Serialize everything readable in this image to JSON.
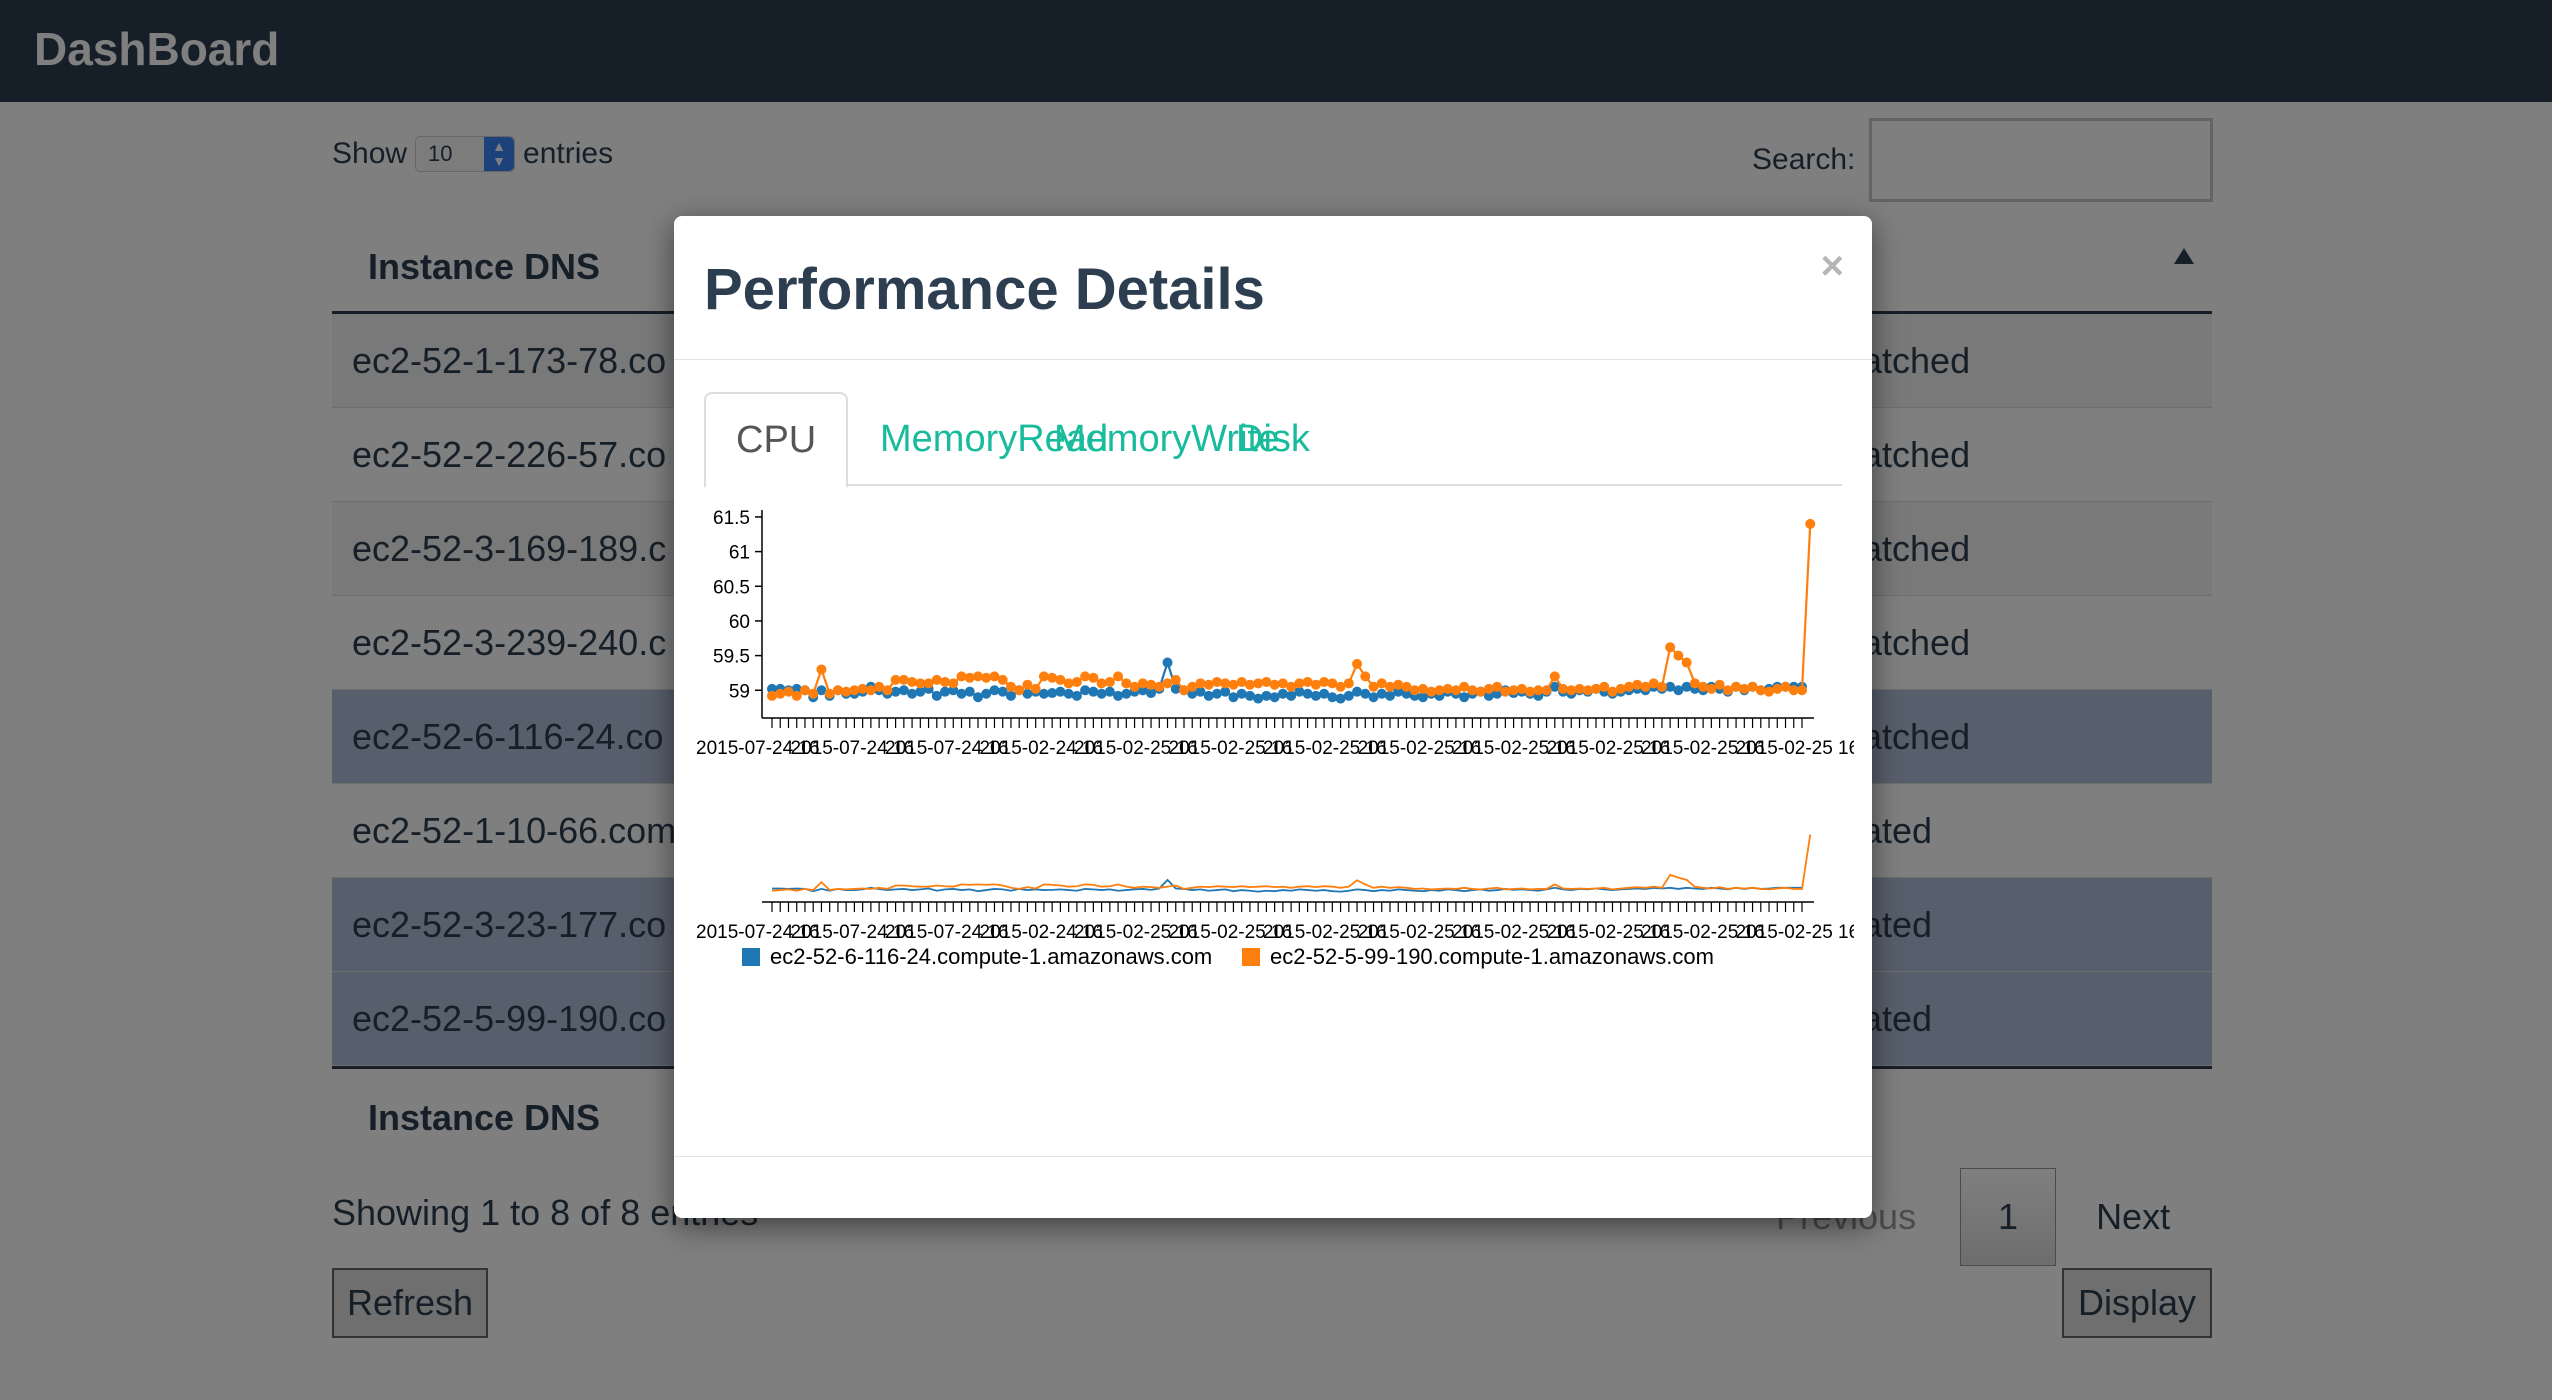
{
  "app": {
    "brand": "DashBoard"
  },
  "length_control": {
    "show_label": "Show",
    "value": "10",
    "entries_label": "entries"
  },
  "search": {
    "label": "Search:",
    "value": ""
  },
  "table": {
    "header": "Instance DNS",
    "footer": "Instance DNS",
    "rows": [
      {
        "dns": "ec2-52-1-173-78.co",
        "status": "atched",
        "selected": false
      },
      {
        "dns": "ec2-52-2-226-57.co",
        "status": "atched",
        "selected": false
      },
      {
        "dns": "ec2-52-3-169-189.c",
        "status": "atched",
        "selected": false
      },
      {
        "dns": "ec2-52-3-239-240.c",
        "status": "atched",
        "selected": false
      },
      {
        "dns": "ec2-52-6-116-24.co",
        "status": "atched",
        "selected": true
      },
      {
        "dns": "ec2-52-1-10-66.com",
        "status": "ated",
        "selected": false
      },
      {
        "dns": "ec2-52-3-23-177.co",
        "status": "ated",
        "selected": true
      },
      {
        "dns": "ec2-52-5-99-190.co",
        "status": "ated",
        "selected": true
      }
    ]
  },
  "info": "Showing 1 to 8 of 8 entries",
  "pagination": {
    "previous": "Previous",
    "current": "1",
    "next": "Next"
  },
  "buttons": {
    "refresh": "Refresh",
    "display": "Display"
  },
  "modal": {
    "title": "Performance Details",
    "close_glyph": "×",
    "tabs": [
      "CPU",
      "MemoryRead",
      "MemoryWrite",
      "Disk"
    ],
    "active_tab": "CPU"
  },
  "chart_data": {
    "type": "line",
    "y_ticks": [
      59,
      59.5,
      60,
      60.5,
      61,
      61.5
    ],
    "ylim": [
      58.6,
      61.6
    ],
    "x_tick_labels": [
      "2015-07-24 16",
      "2015-07-24 16",
      "2015-07-24 16",
      "2015-02-24 16",
      "2015-02-25 16",
      "2015-02-25 16",
      "2015-02-25 16",
      "2015-02-25 16",
      "2015-02-25 16",
      "2015-02-25 16",
      "2015-02-25 16",
      "2015-02-25 16"
    ],
    "series": [
      {
        "name": "ec2-52-6-116-24.compute-1.amazonaws.com",
        "color": "#1f77b4",
        "values": [
          59.02,
          59.02,
          59.0,
          59.02,
          59.0,
          58.9,
          59.0,
          58.92,
          59.0,
          58.95,
          58.95,
          58.98,
          59.05,
          59.0,
          58.95,
          58.98,
          59.0,
          58.95,
          58.98,
          59.02,
          58.92,
          58.98,
          59.0,
          58.95,
          58.98,
          58.9,
          58.95,
          59.0,
          58.98,
          58.92,
          59.0,
          58.95,
          58.98,
          58.95,
          58.96,
          58.98,
          58.95,
          58.92,
          59.0,
          58.98,
          58.95,
          58.98,
          58.92,
          58.95,
          58.98,
          59.0,
          58.96,
          59.02,
          59.4,
          59.02,
          59.0,
          58.95,
          58.98,
          58.92,
          58.95,
          58.98,
          58.9,
          58.95,
          58.92,
          58.88,
          58.92,
          58.9,
          58.95,
          58.92,
          58.98,
          58.95,
          58.92,
          58.95,
          58.9,
          58.88,
          58.92,
          58.98,
          58.95,
          58.9,
          58.95,
          58.92,
          58.98,
          58.95,
          58.92,
          58.9,
          58.95,
          58.92,
          58.98,
          58.95,
          58.9,
          58.95,
          58.98,
          58.92,
          58.95,
          59.0,
          58.96,
          58.98,
          58.95,
          58.92,
          58.98,
          59.05,
          58.98,
          58.95,
          59.0,
          58.98,
          59.02,
          58.98,
          58.95,
          58.98,
          59.0,
          59.02,
          59.0,
          59.05,
          59.02,
          59.05,
          59.0,
          59.05,
          59.02,
          59.0,
          59.05,
          59.02,
          58.98,
          59.05,
          59.0,
          59.05,
          59.0,
          59.02,
          59.05,
          59.05,
          59.05,
          59.05
        ]
      },
      {
        "name": "ec2-52-5-99-190.compute-1.amazonaws.com",
        "color": "#ff7f0e",
        "values": [
          58.92,
          58.95,
          58.98,
          58.92,
          59.0,
          58.95,
          59.3,
          58.95,
          59.0,
          58.98,
          59.0,
          59.02,
          59.0,
          59.05,
          59.0,
          59.15,
          59.15,
          59.12,
          59.1,
          59.1,
          59.15,
          59.12,
          59.1,
          59.2,
          59.18,
          59.2,
          59.18,
          59.2,
          59.15,
          59.05,
          59.0,
          59.08,
          59.02,
          59.2,
          59.18,
          59.15,
          59.1,
          59.12,
          59.2,
          59.18,
          59.1,
          59.12,
          59.2,
          59.1,
          59.05,
          59.1,
          59.08,
          59.05,
          59.1,
          59.15,
          59.0,
          59.05,
          59.1,
          59.08,
          59.12,
          59.1,
          59.08,
          59.12,
          59.08,
          59.1,
          59.12,
          59.08,
          59.1,
          59.05,
          59.1,
          59.12,
          59.08,
          59.12,
          59.1,
          59.05,
          59.1,
          59.38,
          59.2,
          59.05,
          59.1,
          59.05,
          59.08,
          59.05,
          59.0,
          59.02,
          58.98,
          59.0,
          59.02,
          59.0,
          59.05,
          59.0,
          58.98,
          59.02,
          59.05,
          58.98,
          59.0,
          59.02,
          58.98,
          59.0,
          59.0,
          59.2,
          59.02,
          59.0,
          59.02,
          59.0,
          59.02,
          59.05,
          58.98,
          59.02,
          59.05,
          59.08,
          59.05,
          59.1,
          59.05,
          59.62,
          59.5,
          59.4,
          59.1,
          59.05,
          59.02,
          59.08,
          59.0,
          59.05,
          59.02,
          59.05,
          59.0,
          58.98,
          59.02,
          59.05,
          59.0,
          59.0,
          61.4
        ]
      }
    ]
  }
}
